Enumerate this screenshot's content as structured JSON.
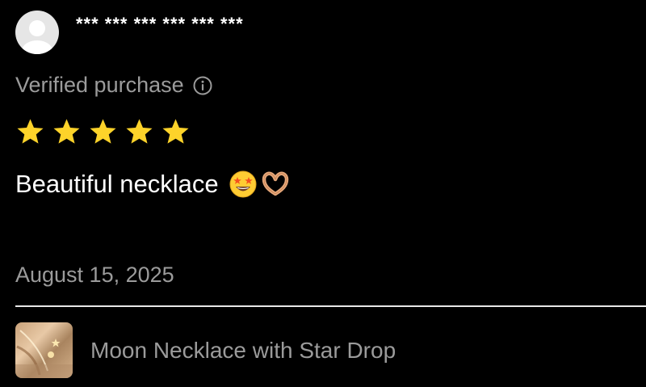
{
  "review": {
    "username": "*** *** *** *** *** ***",
    "verified_label": "Verified purchase",
    "rating": 5,
    "rating_max": 5,
    "text": "Beautiful necklace",
    "emojis": [
      "star-struck-emoji",
      "heart-hands-emoji"
    ],
    "date": "August 15, 2025"
  },
  "product": {
    "name": "Moon Necklace with Star Drop"
  },
  "colors": {
    "background": "#000000",
    "primary_text": "#ffffff",
    "secondary_text": "#9b9b9b",
    "star": "#fdd32a",
    "divider": "#e8e8e8"
  },
  "icons": {
    "avatar": "default-avatar-icon",
    "verified_info": "info-circle-icon",
    "star": "star-icon"
  }
}
